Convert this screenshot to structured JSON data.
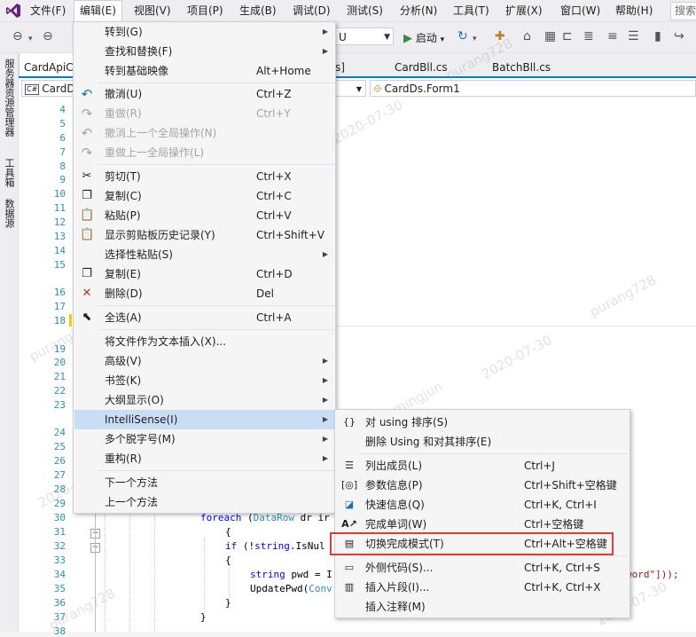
{
  "menubar": {
    "items": [
      "文件(F)",
      "编辑(E)",
      "视图(V)",
      "项目(P)",
      "生成(B)",
      "调试(D)",
      "测试(S)",
      "分析(N)",
      "工具(T)",
      "扩展(X)",
      "窗口(W)",
      "帮助(H)"
    ],
    "search_placeholder": "搜索"
  },
  "toolbar": {
    "config_value": "U",
    "start_label": "启动"
  },
  "left_strip": [
    "服务器资源管理器",
    "工具箱",
    "数据源"
  ],
  "tabs": [
    "CardApiC",
    "s]",
    "CardBll.cs",
    "BatchBll.cs"
  ],
  "navbar": {
    "left_combo": "CardD",
    "right_combo": "CardDs.Form1"
  },
  "line_numbers": [
    "4",
    "5",
    "6",
    "7",
    "8",
    "9",
    "10",
    "11",
    "12",
    "13",
    "14",
    "15",
    "16",
    "17",
    "18",
    "19",
    "20",
    "21",
    "22",
    "23",
    "24",
    "25",
    "26",
    "27",
    "28",
    "29",
    "30",
    "31",
    "32",
    "33",
    "34",
    "35",
    "36",
    "37",
    "38"
  ],
  "code_lines": {
    "l30": [
      "foreach",
      " (",
      "DataRow",
      " dr ir"
    ],
    "l31": "{",
    "l32": [
      "if",
      " (!",
      "string",
      ".IsNul"
    ],
    "l33": "{",
    "l34": [
      "string",
      " pwd = I"
    ],
    "l34_tail": "word\"]));",
    "l35": [
      "UpdatePwd(",
      "Conv"
    ],
    "l36": "}",
    "l37": "}"
  },
  "edit_menu": [
    {
      "label": "转到(G)",
      "shortcut": "",
      "icon": "",
      "submenu": true,
      "disabled": false
    },
    {
      "label": "查找和替换(F)",
      "shortcut": "",
      "icon": "",
      "submenu": true,
      "disabled": false
    },
    {
      "label": "转到基础映像",
      "shortcut": "Alt+Home",
      "icon": "",
      "submenu": false,
      "disabled": false
    },
    {
      "label": "撤消(U)",
      "shortcut": "Ctrl+Z",
      "icon": "undo-icon",
      "submenu": false,
      "disabled": false
    },
    {
      "label": "重做(R)",
      "shortcut": "Ctrl+Y",
      "icon": "redo-icon",
      "submenu": false,
      "disabled": true
    },
    {
      "label": "撤消上一个全局操作(N)",
      "shortcut": "",
      "icon": "undo-global-icon",
      "submenu": false,
      "disabled": true
    },
    {
      "label": "重做上一全局操作(L)",
      "shortcut": "",
      "icon": "redo-global-icon",
      "submenu": false,
      "disabled": true
    },
    {
      "label": "剪切(T)",
      "shortcut": "Ctrl+X",
      "icon": "scissors-icon",
      "submenu": false,
      "disabled": false
    },
    {
      "label": "复制(C)",
      "shortcut": "Ctrl+C",
      "icon": "copy-icon",
      "submenu": false,
      "disabled": false
    },
    {
      "label": "粘贴(P)",
      "shortcut": "Ctrl+V",
      "icon": "paste-icon",
      "submenu": false,
      "disabled": false
    },
    {
      "label": "显示剪贴板历史记录(Y)",
      "shortcut": "Ctrl+Shift+V",
      "icon": "clipboard-history-icon",
      "submenu": false,
      "disabled": false
    },
    {
      "label": "选择性粘贴(S)",
      "shortcut": "",
      "icon": "",
      "submenu": true,
      "disabled": false
    },
    {
      "label": "复制(E)",
      "shortcut": "Ctrl+D",
      "icon": "duplicate-icon",
      "submenu": false,
      "disabled": false
    },
    {
      "label": "删除(D)",
      "shortcut": "Del",
      "icon": "delete-icon",
      "submenu": false,
      "disabled": false
    },
    {
      "label": "全选(A)",
      "shortcut": "Ctrl+A",
      "icon": "select-all-icon",
      "submenu": false,
      "disabled": false
    },
    {
      "label": "将文件作为文本插入(X)...",
      "shortcut": "",
      "icon": "",
      "submenu": false,
      "disabled": false
    },
    {
      "label": "高级(V)",
      "shortcut": "",
      "icon": "",
      "submenu": true,
      "disabled": false
    },
    {
      "label": "书签(K)",
      "shortcut": "",
      "icon": "",
      "submenu": true,
      "disabled": false
    },
    {
      "label": "大纲显示(O)",
      "shortcut": "",
      "icon": "",
      "submenu": true,
      "disabled": false
    },
    {
      "label": "IntelliSense(I)",
      "shortcut": "",
      "icon": "",
      "submenu": true,
      "disabled": false,
      "highlighted": true
    },
    {
      "label": "多个脱字号(M)",
      "shortcut": "",
      "icon": "",
      "submenu": true,
      "disabled": false
    },
    {
      "label": "重构(R)",
      "shortcut": "",
      "icon": "",
      "submenu": true,
      "disabled": false
    },
    {
      "label": "下一个方法",
      "shortcut": "",
      "icon": "",
      "submenu": false,
      "disabled": false
    },
    {
      "label": "上一个方法",
      "shortcut": "",
      "icon": "",
      "submenu": false,
      "disabled": false
    }
  ],
  "intellisense_menu": [
    {
      "label": "对 using 排序(S)",
      "shortcut": "",
      "icon": "sort-usings-icon"
    },
    {
      "label": "删除 Using 和对其排序(E)",
      "shortcut": "",
      "icon": ""
    },
    {
      "label": "列出成员(L)",
      "shortcut": "Ctrl+J",
      "icon": "list-members-icon"
    },
    {
      "label": "参数信息(P)",
      "shortcut": "Ctrl+Shift+空格键",
      "icon": "parameter-info-icon"
    },
    {
      "label": "快速信息(Q)",
      "shortcut": "Ctrl+K, Ctrl+I",
      "icon": "quick-info-icon"
    },
    {
      "label": "完成单词(W)",
      "shortcut": "Ctrl+空格键",
      "icon": "complete-word-icon"
    },
    {
      "label": "切换完成模式(T)",
      "shortcut": "Ctrl+Alt+空格键",
      "icon": "toggle-completion-icon",
      "highlighted": true
    },
    {
      "label": "外侧代码(S)...",
      "shortcut": "Ctrl+K, Ctrl+S",
      "icon": "surround-with-icon"
    },
    {
      "label": "插入片段(I)...",
      "shortcut": "Ctrl+K, Ctrl+X",
      "icon": "insert-snippet-icon"
    },
    {
      "label": "插入注释(M)",
      "shortcut": "",
      "icon": ""
    }
  ],
  "watermarks": [
    "purang728",
    "2020-07-30",
    "purang728",
    "2020-07-30",
    "mingjun",
    "2020-07-30",
    "purang728",
    "2020-07-30",
    "purang728"
  ],
  "colors": {
    "accent": "#007acc",
    "highlight_box": "#e03c31",
    "menu_hover": "#c9def5"
  }
}
